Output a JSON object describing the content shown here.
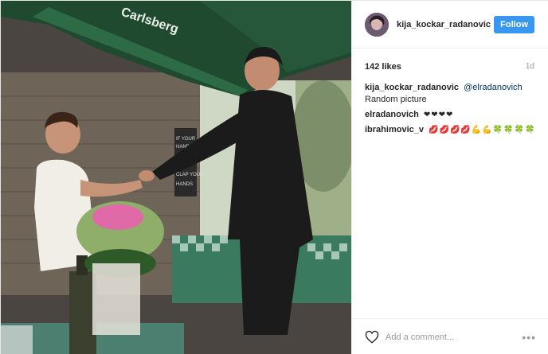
{
  "post": {
    "image_alt": "Wedding photo of a couple dancing",
    "photo_sign_lines": [
      "IF YOUR",
      "HANDS",
      "CLAP YOUR",
      "HANDS"
    ],
    "awning_text": "Carlsberg",
    "author": {
      "username": "kija_kockar_radanovic",
      "follow_label": "Follow"
    },
    "likes_label": "142 likes",
    "time_label": "1d",
    "comments": [
      {
        "user": "kija_kockar_radanovic",
        "mention": "@elradanovich",
        "text": "Random picture"
      },
      {
        "user": "elradanovich",
        "text": "❤❤❤❤"
      },
      {
        "user": "ibrahimovic_v",
        "text": "💋💋💋💋💪💪🍀🍀🍀🍀"
      }
    ],
    "add_comment_placeholder": "Add a comment...",
    "more_label": "•••"
  },
  "colors": {
    "follow_bg": "#3897f0",
    "username": "#262626",
    "mention": "#003569",
    "muted": "#999999"
  },
  "icons": [
    "avatar",
    "heart-icon",
    "more-options-icon"
  ]
}
